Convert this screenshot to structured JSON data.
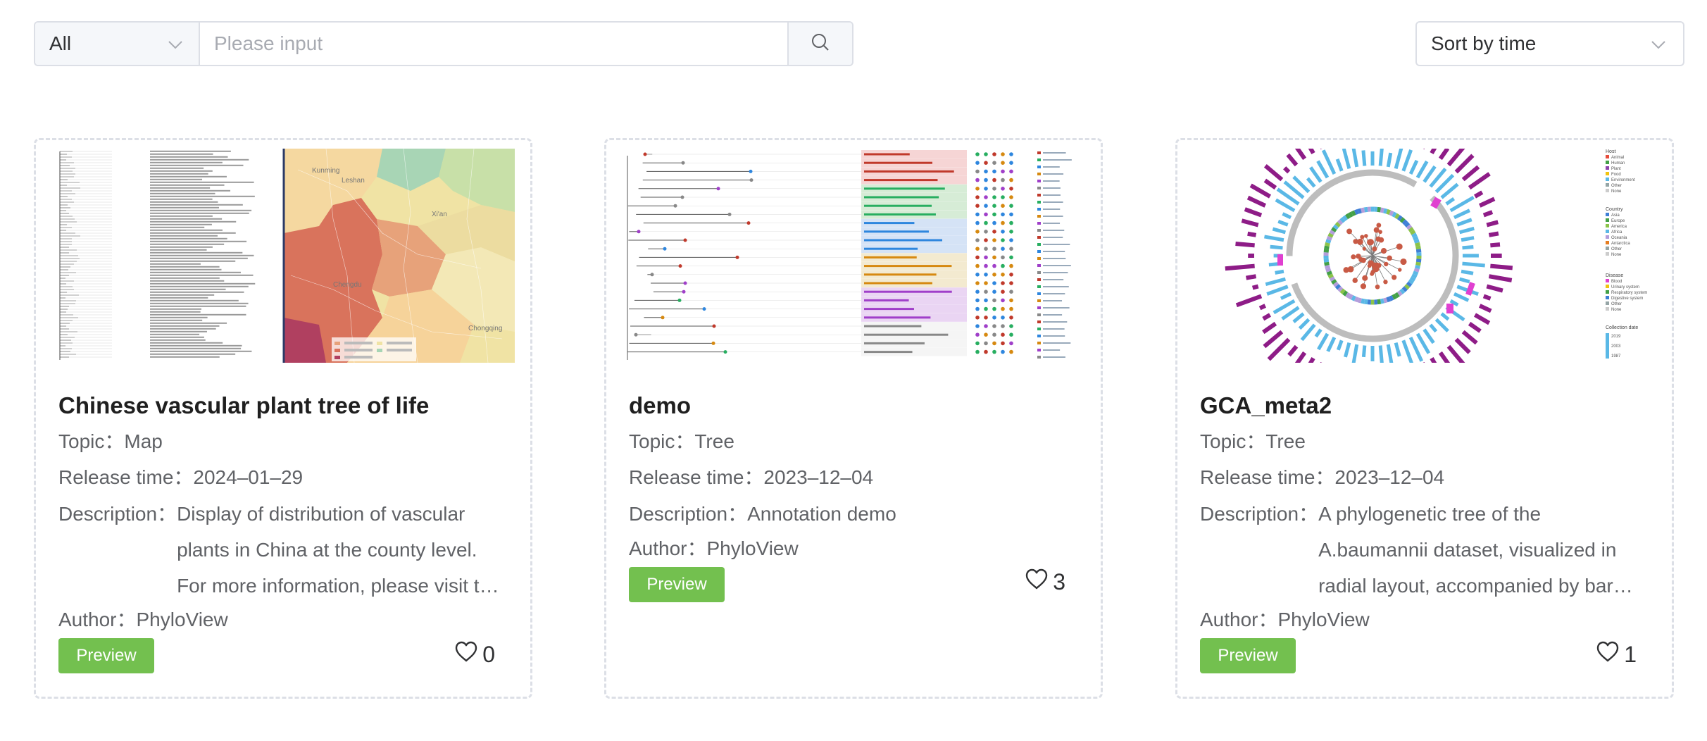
{
  "toolbar": {
    "category_value": "All",
    "search_placeholder": "Please input",
    "sort_value": "Sort by time"
  },
  "cards": [
    {
      "title": "Chinese vascular plant tree of life",
      "topic": "Topic：Map",
      "release": "Release time：2024–01–29",
      "description_label": "Description：",
      "description": "Display of distribution of vascular plants in China at the county level. For more information, please visit the website.",
      "author": "Author：PhyloView",
      "preview_label": "Preview",
      "likes": "0",
      "map_labels": [
        "Chengdu",
        "Leshan",
        "Xi'an",
        "Chongqing",
        "Kunming"
      ]
    },
    {
      "title": "demo",
      "topic": "Topic：Tree",
      "release": "Release time：2023–12–04",
      "description_label": "Description：",
      "description": "Annotation demo",
      "author": "Author：PhyloView",
      "preview_label": "Preview",
      "likes": "3"
    },
    {
      "title": "GCA_meta2",
      "topic": "Topic：Tree",
      "release": "Release time：2023–12–04",
      "description_label": "Description：",
      "description": "A phylogenetic tree of the A.baumannii dataset, visualized in radial layout, accompanied by bar charts and annotation rings.",
      "author": "Author：PhyloView",
      "preview_label": "Preview",
      "likes": "1",
      "legend": {
        "host_title": "Host",
        "host_items": [
          "Animal",
          "Human",
          "Plant",
          "Food",
          "Environment",
          "Other",
          "None"
        ],
        "country_title": "Country",
        "country_items": [
          "Asia",
          "Europe",
          "America",
          "Africa",
          "Oceania",
          "Antarctica",
          "Other",
          "None"
        ],
        "disease_title": "Disease",
        "disease_items": [
          "Blood",
          "Urinary system",
          "Respiratory system",
          "Digestive system",
          "Other",
          "None"
        ],
        "date_title": "Collection date",
        "date_items": [
          "2019",
          "2003",
          "1987"
        ]
      }
    }
  ],
  "colors": {
    "preview_green": "#73c04f",
    "border_gray": "#dcdfe6",
    "bar_purple": "#8e1c87",
    "bar_blue": "#5ab8e6",
    "map_red": "#d9735c",
    "map_yellow": "#f0e3a4"
  },
  "icons": {
    "search": "search-icon",
    "chevron": "chevron-down-icon",
    "heart": "heart-icon"
  }
}
